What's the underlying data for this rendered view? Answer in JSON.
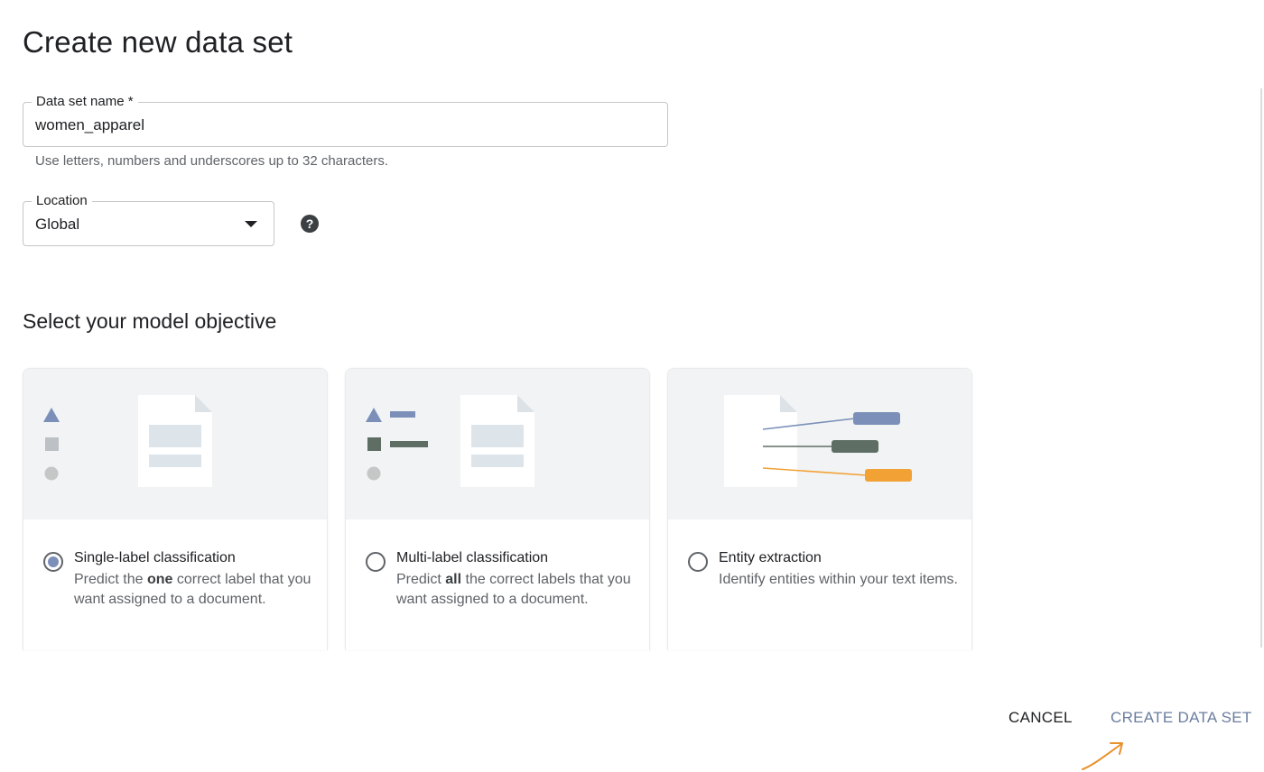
{
  "page": {
    "title": "Create new data set"
  },
  "name_field": {
    "label": "Data set name *",
    "value": "women_apparel",
    "hint": "Use letters, numbers and underscores up to 32 characters."
  },
  "location_field": {
    "label": "Location",
    "value": "Global",
    "help_icon": "?"
  },
  "objective": {
    "title": "Select your model objective",
    "options": [
      {
        "title": "Single-label classification",
        "desc_before": "Predict the ",
        "desc_bold": "one",
        "desc_after": " correct label that you want assigned to a document.",
        "selected": true
      },
      {
        "title": "Multi-label classification",
        "desc_before": "Predict ",
        "desc_bold": "all",
        "desc_after": " the correct labels that you want assigned to a document.",
        "selected": false
      },
      {
        "title": "Entity extraction",
        "desc_before": "Identify entities within your text items.",
        "desc_bold": "",
        "desc_after": "",
        "selected": false
      }
    ]
  },
  "actions": {
    "cancel": "CANCEL",
    "create": "CREATE DATA SET"
  },
  "colors": {
    "accent": "#6a7d9e",
    "shape_blue": "#7b8fb8",
    "shape_green": "#5f6e64",
    "shape_orange": "#f2a134",
    "card_header_bg": "#f1f3f4",
    "annotation_arrow": "#e8912d"
  }
}
